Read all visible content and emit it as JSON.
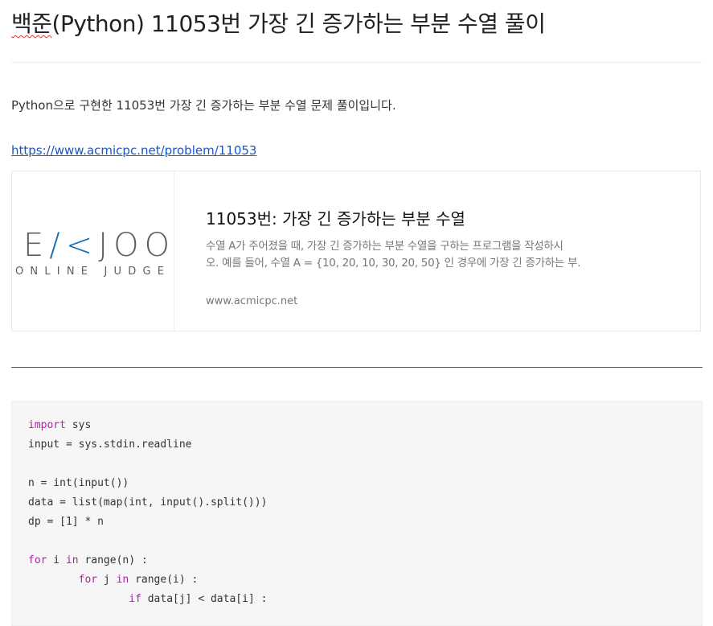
{
  "post": {
    "title_part1": "백준",
    "title_part2": "(Python) 11053번 가장 긴 증가하는 부분 수열 풀이",
    "intro": "Python으로 구현한 11053번 가장 긴 증가하는 부분 수열 문제 풀이입니다.",
    "link": "https://www.acmicpc.net/problem/11053"
  },
  "card": {
    "logo_left": "E",
    "logo_k": "/<",
    "logo_right": "JOO",
    "logo_sub": "ONLINE JUDGE",
    "title": "11053번: 가장 긴 증가하는 부분 수열",
    "desc_line1": "수열 A가 주어졌을 때, 가장 긴 증가하는 부분 수열을 구하는 프로그램을 작성하시",
    "desc_line2": "오. 예를 들어, 수열 A = {10, 20, 10, 30, 20, 50} 인 경우에 가장 긴 증가하는 부…",
    "host": "www.acmicpc.net"
  },
  "code": {
    "l1_kw": "import",
    "l1_rest": " sys",
    "l2": "input = sys.stdin.readline",
    "l4": "n = int(input())",
    "l5": "data = list(map(int, input().split()))",
    "l6": "dp = [1] * n",
    "l8_kw1": "for",
    "l8_a": " i ",
    "l8_kw2": "in",
    "l8_b": " range(n) :",
    "l9_indent": "        ",
    "l9_kw1": "for",
    "l9_a": " j ",
    "l9_kw2": "in",
    "l9_b": " range(i) :",
    "l10_indent": "                ",
    "l10_kw": "if",
    "l10_rest": " data[j] < data[i] :"
  },
  "colors": {
    "link": "#1a55c7",
    "keyword": "#a626a4",
    "logo_accent": "#1f6fb5"
  }
}
